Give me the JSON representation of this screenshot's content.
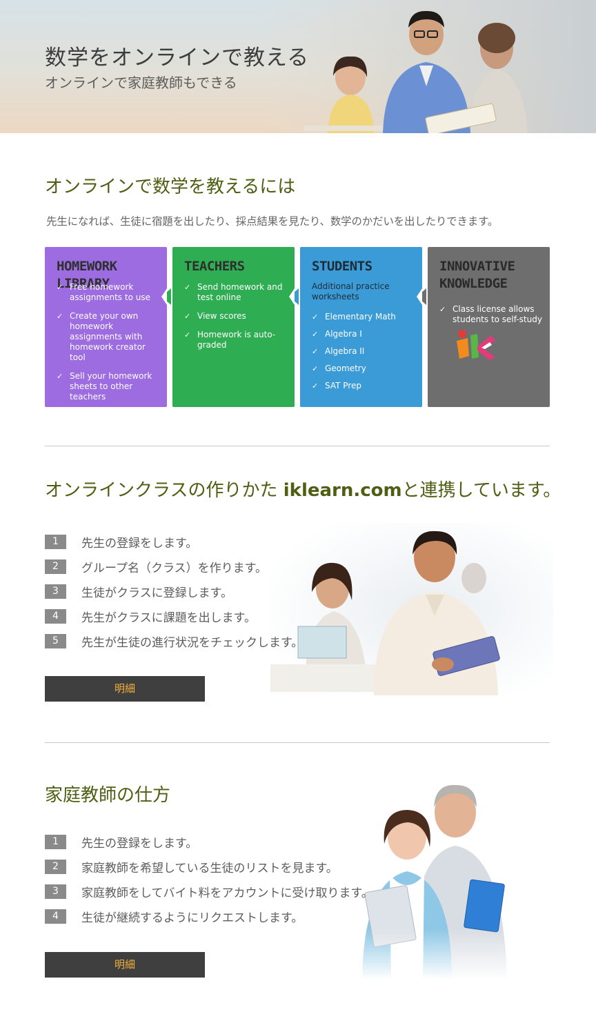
{
  "hero": {
    "title": "数学をオンラインで教える",
    "subtitle": "オンラインで家庭教師もできる"
  },
  "teach": {
    "heading": "オンラインで数学を教えるには",
    "intro": "先生になれば、生徒に宿題を出したり、採点結果を見たり、数学のかだいを出したりできます。"
  },
  "cards": [
    {
      "title_line1": "HOMEWORK LIBRARY",
      "color": "#9c6ce0",
      "items": [
        "Free homework assignments to use",
        "Create your own homework assignments with homework creator tool",
        "Sell your homework sheets to other teachers"
      ]
    },
    {
      "title_line1": "TEACHERS",
      "color": "#2fad52",
      "items": [
        "Send homework and test online",
        "View scores",
        "Homework is auto-graded"
      ]
    },
    {
      "title_line1": "STUDENTS",
      "color": "#3a9bd7",
      "subtitle": "Additional practice worksheets",
      "items": [
        "Elementary Math",
        "Algebra I",
        "Algebra II",
        "Geometry",
        "SAT Prep"
      ]
    },
    {
      "title_line1": "INNOVATIVE",
      "title_line2": "KNOWLEDGE",
      "color": "#6e6e6e",
      "items": [
        "Class license allows students to self-study"
      ],
      "logo_icon": "ik-logo-icon"
    }
  ],
  "online_class": {
    "heading_before": "オンラインクラスの作りかた ",
    "heading_strong": "iklearn.com",
    "heading_after": "と連携しています。",
    "steps": [
      {
        "num": "1",
        "text": "先生の登録をします。"
      },
      {
        "num": "2",
        "text": "グループ名（クラス）を作ります。"
      },
      {
        "num": "3",
        "text": "生徒がクラスに登録します。"
      },
      {
        "num": "4",
        "text": "先生がクラスに課題を出します。"
      },
      {
        "num": "5",
        "text": "先生が生徒の進行状況をチェックします。"
      }
    ],
    "button_label": "明細"
  },
  "tutoring": {
    "heading": "家庭教師の仕方",
    "steps": [
      {
        "num": "1",
        "text": "先生の登録をします。"
      },
      {
        "num": "2",
        "text": "家庭教師を希望している生徒のリストを見ます。"
      },
      {
        "num": "3",
        "text": "家庭教師をしてバイト料をアカウントに受け取ります。"
      },
      {
        "num": "4",
        "text": "生徒が継続するようにリクエストします。"
      }
    ],
    "button_label": "明細"
  },
  "colors": {
    "heading_green": "#4e5f14",
    "button_bg": "#3f3f3f",
    "button_text": "#f3b13e",
    "step_badge": "#8a8a8a"
  }
}
